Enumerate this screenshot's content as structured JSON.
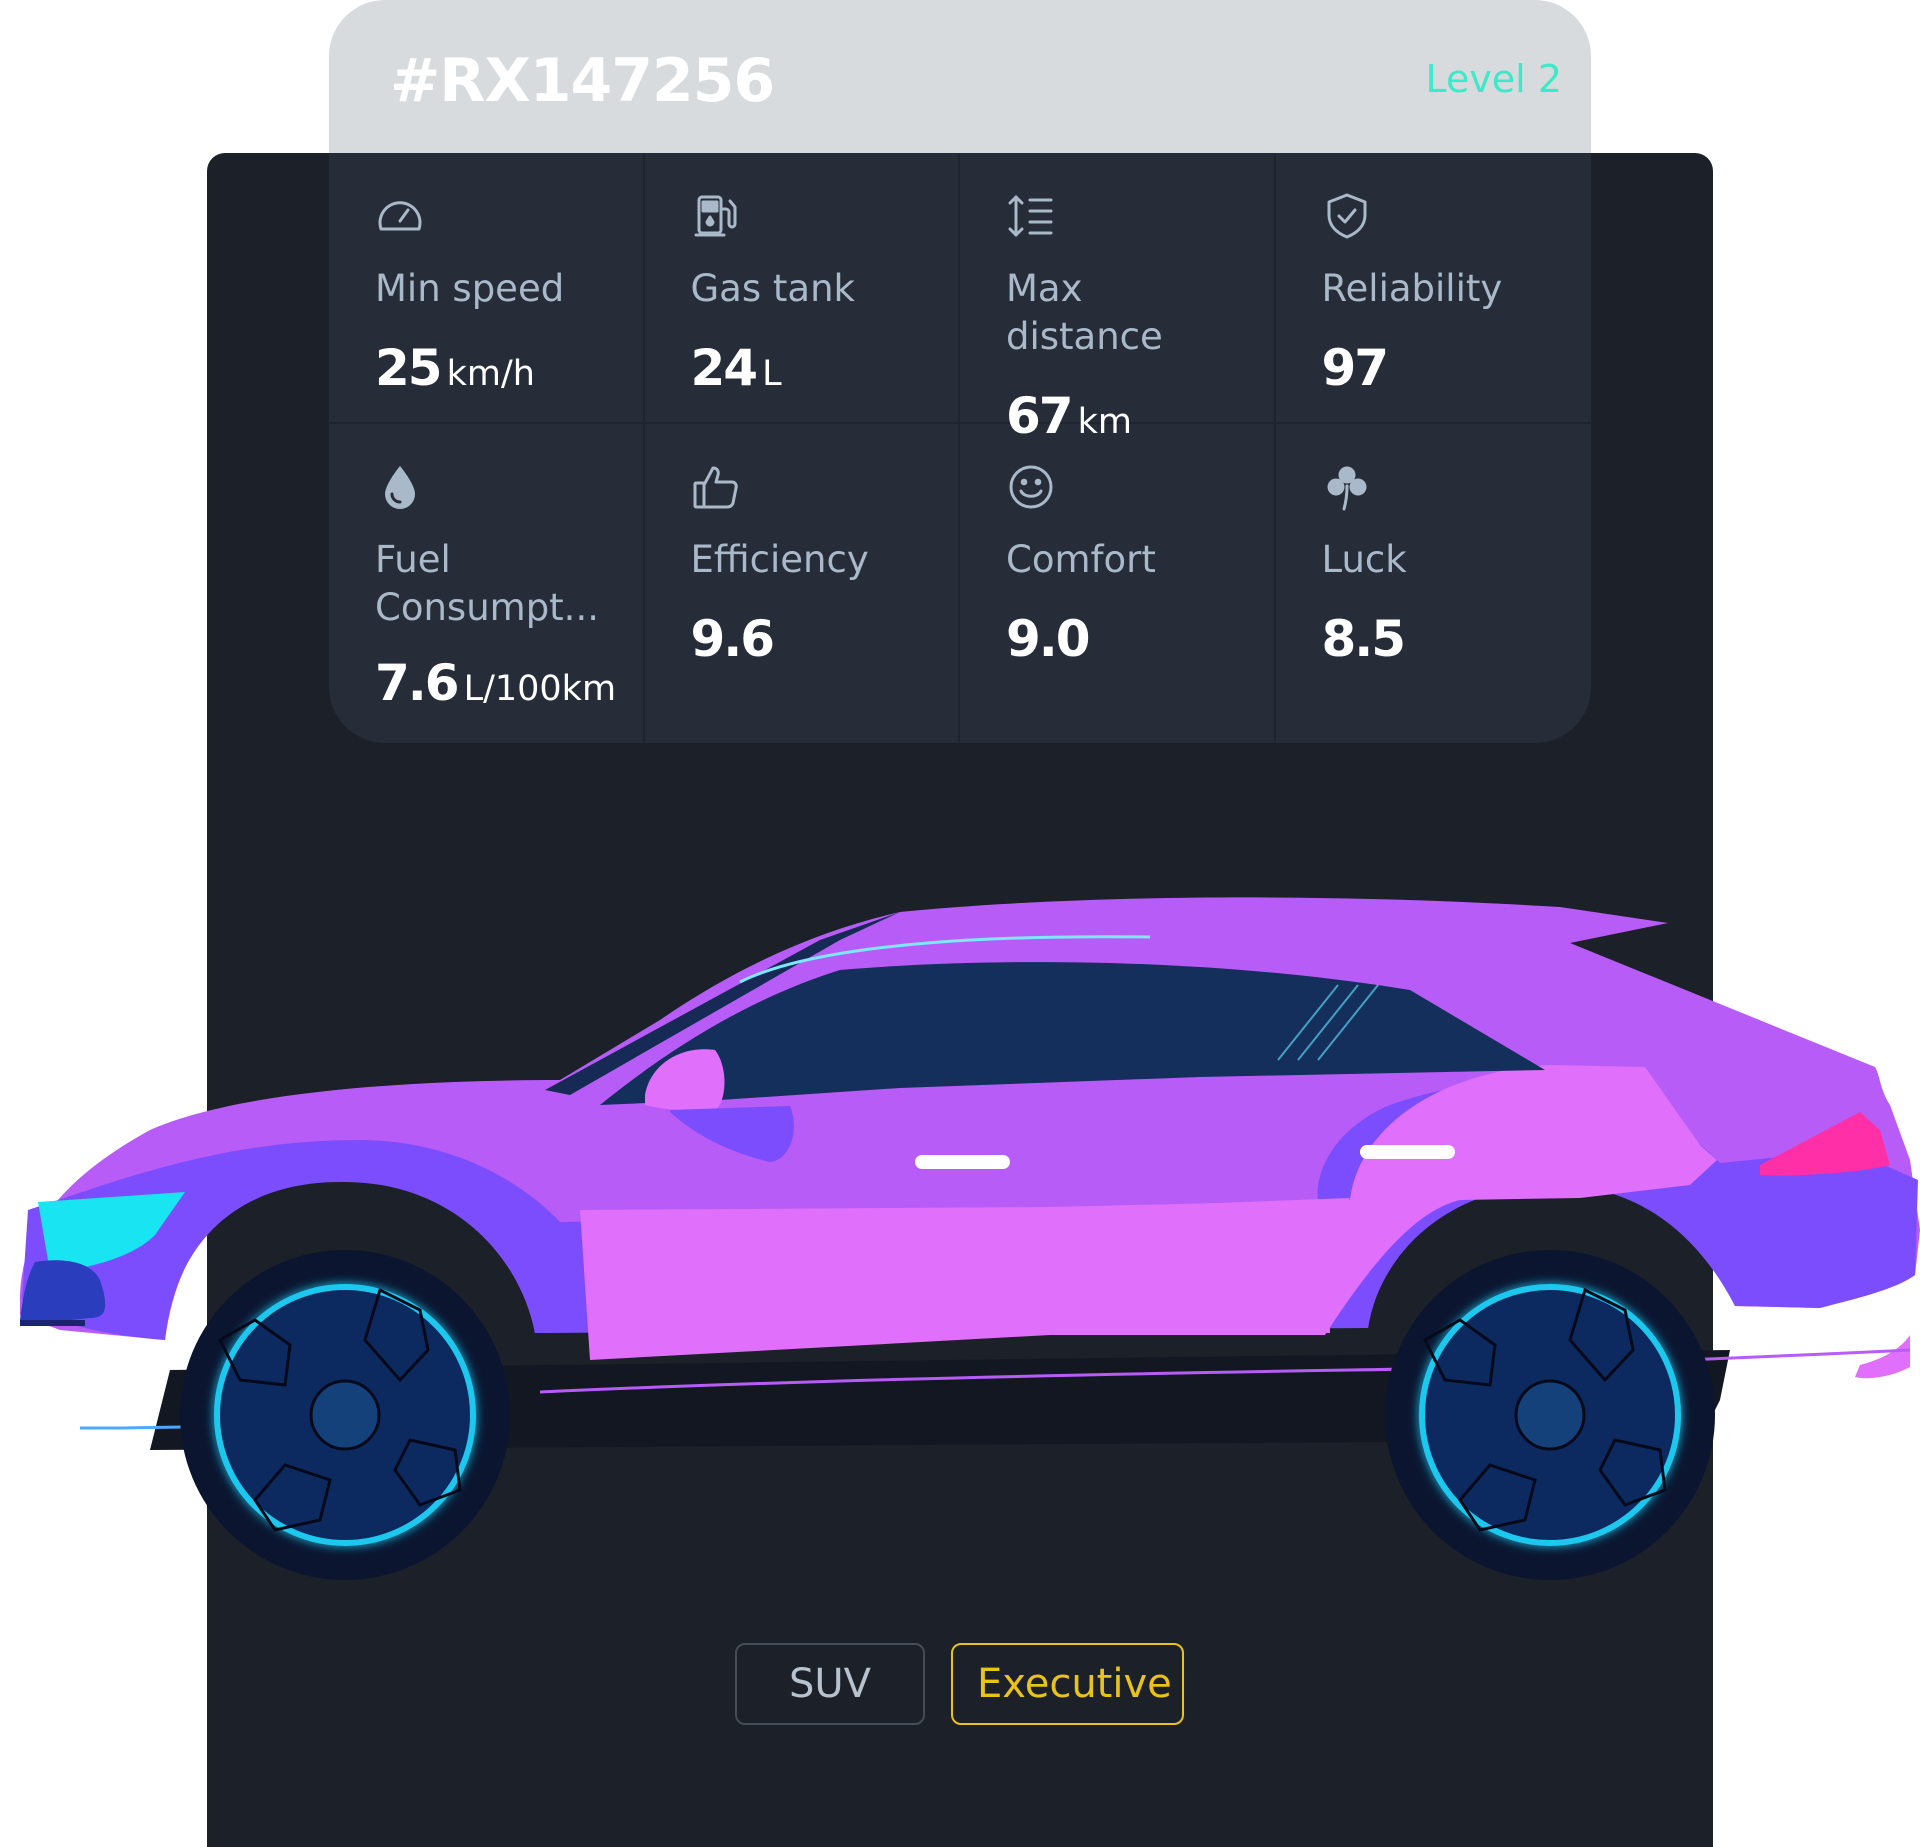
{
  "header": {
    "vehicle_id": "#RX147256",
    "level": "Level 2"
  },
  "stats": [
    {
      "icon": "speedometer-icon",
      "label": "Min speed",
      "value": "25",
      "unit": "km/h"
    },
    {
      "icon": "fuel-pump-icon",
      "label": "Gas tank",
      "value": "24",
      "unit": "L"
    },
    {
      "icon": "distance-icon",
      "label": "Max distance",
      "value": "67",
      "unit": "km"
    },
    {
      "icon": "shield-check-icon",
      "label": "Reliability",
      "value": "97",
      "unit": ""
    },
    {
      "icon": "drop-icon",
      "label": "Fuel Consumpt...",
      "value": "7.6",
      "unit": "L/100km"
    },
    {
      "icon": "thumbs-up-icon",
      "label": "Efficiency",
      "value": "9.6",
      "unit": ""
    },
    {
      "icon": "smiley-icon",
      "label": "Comfort",
      "value": "9.0",
      "unit": ""
    },
    {
      "icon": "clover-icon",
      "label": "Luck",
      "value": "8.5",
      "unit": ""
    }
  ],
  "tags": [
    {
      "label": "SUV"
    },
    {
      "label": "Executive"
    }
  ],
  "colors": {
    "panel_bg": "#1c2028",
    "card_bg": "#262d38",
    "header_bg": "#d8dbde",
    "level_accent": "#3ee8c8",
    "label_text": "#a9b9c9",
    "tag_exec": "#e9c21a",
    "car_body": "#b85cf7",
    "car_lower": "#7c4dfc",
    "car_door": "#e070fb",
    "rim_glow": "#1fc8ee"
  }
}
